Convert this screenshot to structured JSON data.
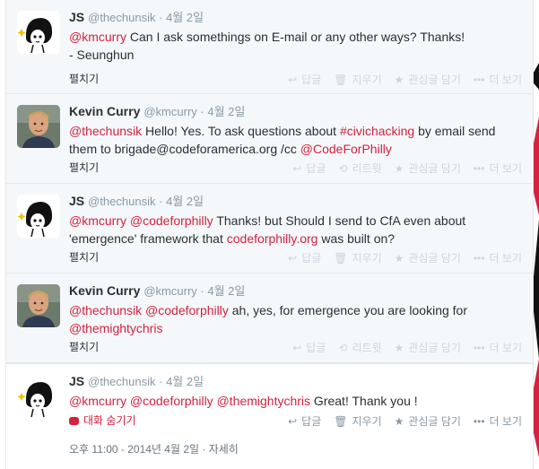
{
  "tweets": [
    {
      "fullname": "JS",
      "username": "@thechunsik",
      "sep": "·",
      "time": "4월 2일",
      "avatar": "js-cartoon-avatar",
      "text_parts": [
        {
          "t": "@kmcurry",
          "type": "mention"
        },
        {
          "t": " Can I ask somethings on E-mail or any other ways? Thanks! ",
          "type": "plain"
        }
      ],
      "text_line2": "- Seunghun",
      "expand": "펼치기",
      "actions": [
        "답글",
        "지우기",
        "관심글 담기",
        "더 보기"
      ]
    },
    {
      "fullname": "Kevin Curry",
      "username": "@kmcurry",
      "sep": "·",
      "time": "4월 2일",
      "avatar": "kevin-photo-avatar",
      "text_parts": [
        {
          "t": "@thechunsik",
          "type": "mention"
        },
        {
          "t": " Hello! Yes. To ask questions about ",
          "type": "plain"
        },
        {
          "t": "#civichacking",
          "type": "hashtag"
        },
        {
          "t": " by email send them to brigade@codeforamerica.org /cc ",
          "type": "plain"
        },
        {
          "t": "@CodeForPhilly",
          "type": "mention"
        }
      ],
      "expand": "펼치기",
      "actions": [
        "답글",
        "리트윗",
        "관심글 담기",
        "더 보기"
      ]
    },
    {
      "fullname": "JS",
      "username": "@thechunsik",
      "sep": "·",
      "time": "4월 2일",
      "avatar": "js-cartoon-avatar",
      "text_parts": [
        {
          "t": "@kmcurry",
          "type": "mention"
        },
        {
          "t": " ",
          "type": "plain"
        },
        {
          "t": "@codeforphilly",
          "type": "mention"
        },
        {
          "t": " Thanks! but Should I send to CfA even about 'emergence' framework that ",
          "type": "plain"
        },
        {
          "t": "codeforphilly.org",
          "type": "link"
        },
        {
          "t": " was built on?",
          "type": "plain"
        }
      ],
      "expand": "펼치기",
      "actions": [
        "답글",
        "지우기",
        "관심글 담기",
        "더 보기"
      ]
    },
    {
      "fullname": "Kevin Curry",
      "username": "@kmcurry",
      "sep": "·",
      "time": "4월 2일",
      "avatar": "kevin-photo-avatar",
      "text_parts": [
        {
          "t": "@thechunsik",
          "type": "mention"
        },
        {
          "t": " ",
          "type": "plain"
        },
        {
          "t": "@codeforphilly",
          "type": "mention"
        },
        {
          "t": " ah, yes, for emergence you are looking for ",
          "type": "plain"
        },
        {
          "t": "@themightychris",
          "type": "mention"
        }
      ],
      "expand": "펼치기",
      "actions": [
        "답글",
        "리트윗",
        "관심글 담기",
        "더 보기"
      ]
    },
    {
      "fullname": "JS",
      "username": "@thechunsik",
      "sep": "·",
      "time": "4월 2일",
      "avatar": "js-cartoon-avatar",
      "text_parts": [
        {
          "t": "@kmcurry",
          "type": "mention"
        },
        {
          "t": " ",
          "type": "plain"
        },
        {
          "t": "@codeforphilly",
          "type": "mention"
        },
        {
          "t": " ",
          "type": "plain"
        },
        {
          "t": "@themightychris",
          "type": "mention"
        },
        {
          "t": " Great! Thank you !",
          "type": "plain"
        }
      ],
      "convo_hide": "대화 숨기기",
      "meta": "오후 11:00 - 2014년 4월 2일 · 자세히",
      "actions": [
        "답글",
        "지우기",
        "관심글 담기",
        "더 보기"
      ]
    }
  ],
  "action_icons": {
    "답글": {
      "glyph": "↩",
      "name": "reply-icon"
    },
    "리트윗": {
      "glyph": "⟲",
      "name": "retweet-icon"
    },
    "지우기": {
      "glyph": "🗑",
      "name": "trash-icon"
    },
    "관심글 담기": {
      "glyph": "★",
      "name": "favorite-star-icon"
    },
    "더 보기": {
      "glyph": "•••",
      "name": "more-dots-icon"
    }
  },
  "colors": {
    "link": "#d4213e",
    "name": "#292f33",
    "muted": "#8899a6",
    "panel": "#f5f8fa",
    "border": "#e1e8ed"
  }
}
